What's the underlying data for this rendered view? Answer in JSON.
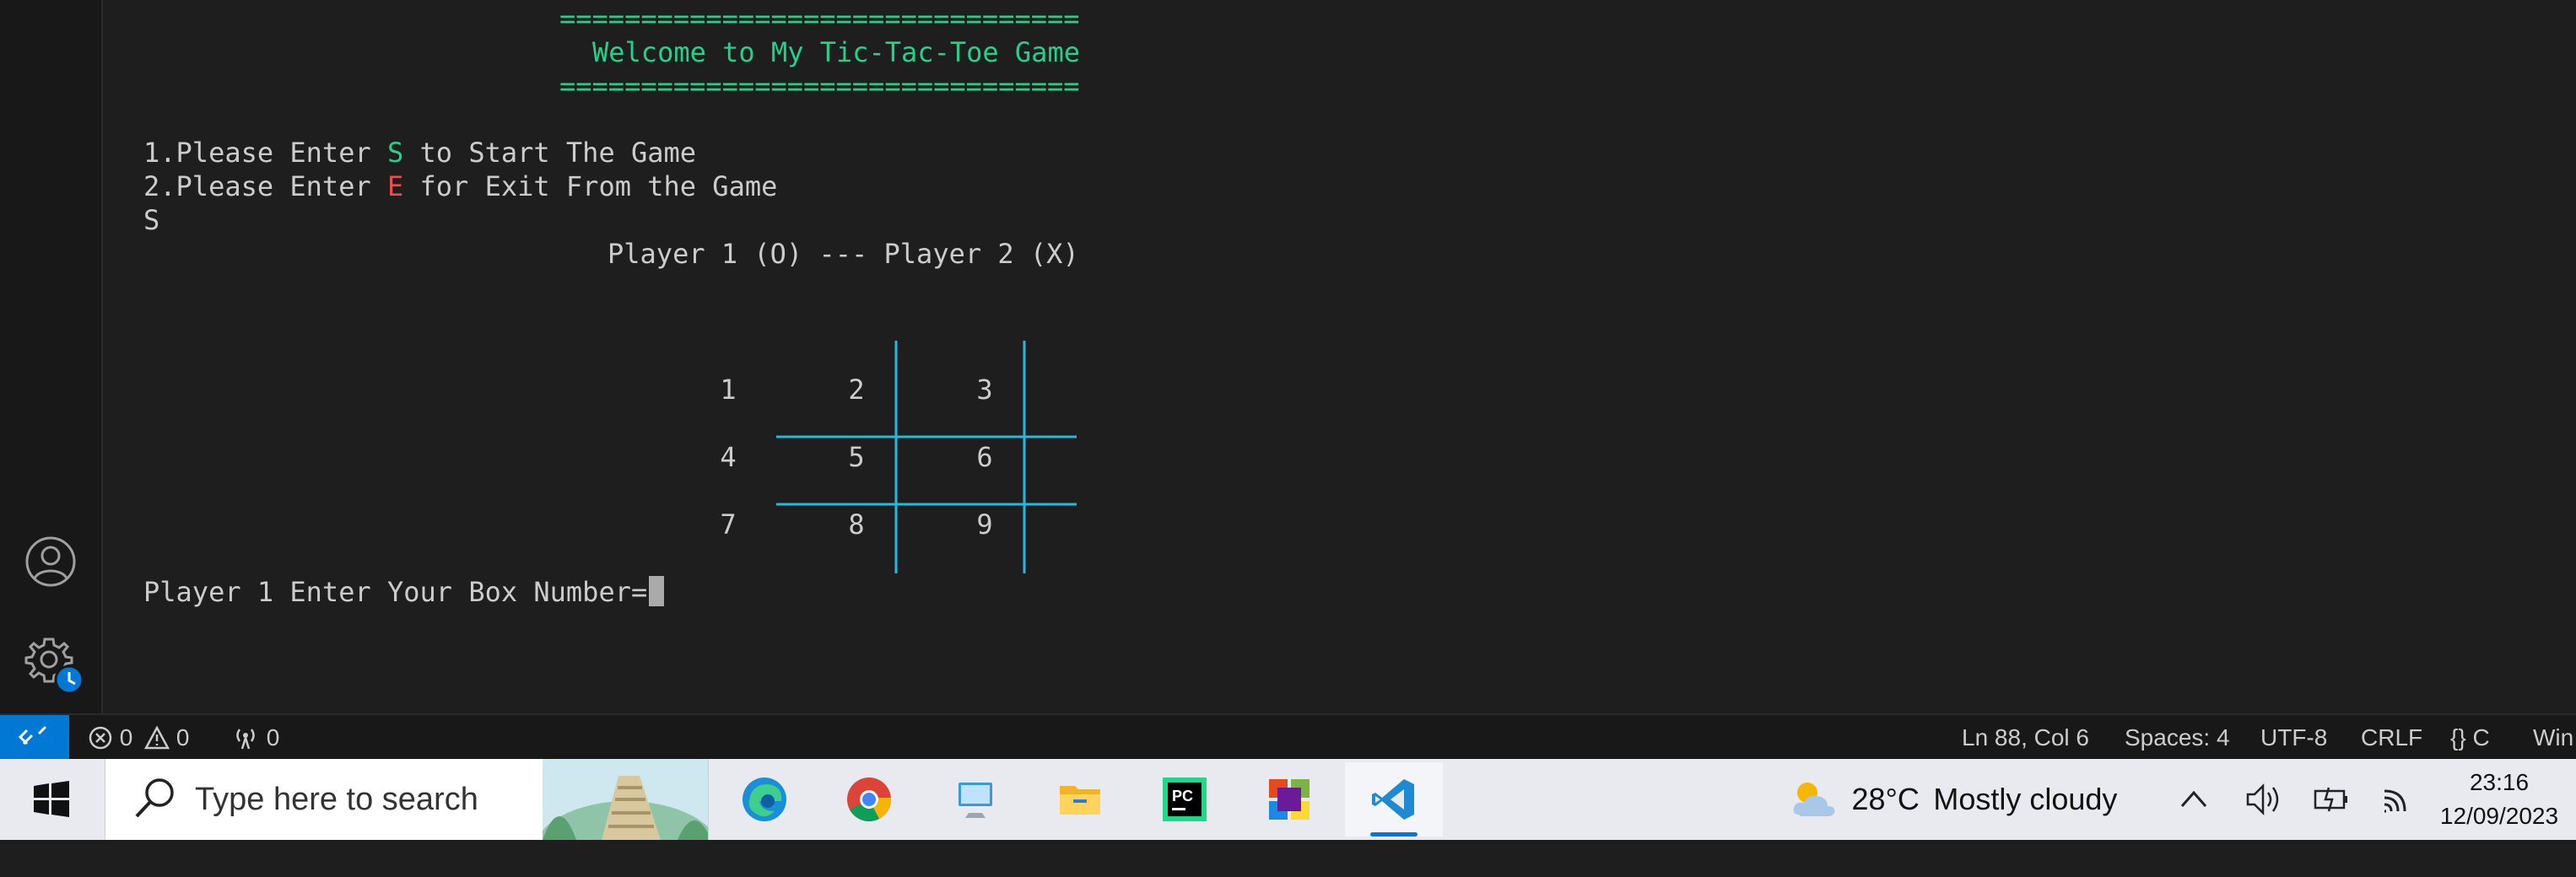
{
  "terminal": {
    "separator_top": "================================",
    "welcome": "Welcome to My Tic-Tac-Toe Game",
    "separator_bottom": "================================",
    "menu": [
      {
        "pre": "1.Please Enter ",
        "key": "S",
        "post": " to Start The Game"
      },
      {
        "pre": "2.Please Enter ",
        "key": "E",
        "post": " for Exit From the Game"
      }
    ],
    "user_input": "S",
    "players": "Player 1 (O) --- Player 2 (X)",
    "board": [
      "1",
      "2",
      "3",
      "4",
      "5",
      "6",
      "7",
      "8",
      "9"
    ],
    "prompt": "Player 1 Enter Your Box Number="
  },
  "status_bar": {
    "errors": "0",
    "warnings": "0",
    "ports": "0",
    "position": "Ln 88, Col 6",
    "spaces": "Spaces: 4",
    "encoding": "UTF-8",
    "eol": "CRLF",
    "language": "C",
    "platform": "Win"
  },
  "taskbar": {
    "search_placeholder": "Type here to search",
    "weather_temp": "28°C",
    "weather_desc": "Mostly cloudy",
    "time": "23:16",
    "date": "12/09/2023",
    "apps": [
      "edge-icon",
      "chrome-icon",
      "this-pc-icon",
      "file-explorer-icon",
      "pycharm-icon",
      "windows-apps-icon",
      "vscode-icon"
    ]
  },
  "colors": {
    "terminal_green": "#23d18b",
    "terminal_red": "#f14c4c",
    "board_lines": "#29b8db",
    "status_remote": "#0078d4"
  }
}
